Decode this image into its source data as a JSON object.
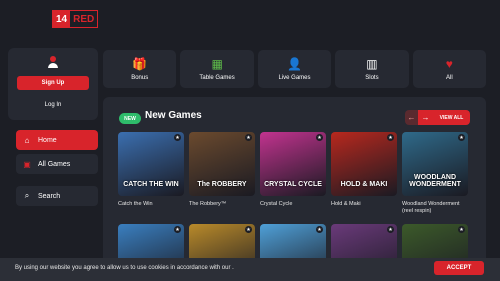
{
  "logo": {
    "number": "14",
    "brand": "RED"
  },
  "account": {
    "signup_label": "Sign Up",
    "login_label": "Log In"
  },
  "nav": [
    {
      "label": "Home",
      "icon": "home-icon",
      "active": true
    },
    {
      "label": "All Games",
      "icon": "cards-icon",
      "active": false
    },
    {
      "label": "Search",
      "icon": "search-icon",
      "active": false
    }
  ],
  "categories": [
    {
      "label": "Bonus",
      "icon": "gift-icon"
    },
    {
      "label": "Table Games",
      "icon": "roulette-icon"
    },
    {
      "label": "Live Games",
      "icon": "dealer-icon"
    },
    {
      "label": "Slots",
      "icon": "slot-machine-icon"
    },
    {
      "label": "All",
      "icon": "playing-cards-icon"
    }
  ],
  "section": {
    "badge": "NEW",
    "title": "New Games",
    "view_all": "VIEW ALL"
  },
  "games": [
    {
      "name": "Catch the Win",
      "art": "CATCH THE WIN",
      "color": "#3b6fb0"
    },
    {
      "name": "The Robbery™",
      "art": "The ROBBERY",
      "color": "#6b4a2e"
    },
    {
      "name": "Crystal Cycle",
      "art": "CRYSTAL CYCLE",
      "color": "#c2338f"
    },
    {
      "name": "Hold & Maki",
      "art": "HOLD & MAKI",
      "color": "#b8281e"
    },
    {
      "name": "Woodland Wonderment (reel respin)",
      "art": "WOODLAND WONDERMENT",
      "color": "#2f6a8a"
    }
  ],
  "games_row2_colors": [
    "#3a7fc0",
    "#b98a2a",
    "#4fa0d8",
    "#6a3a7a",
    "#3c5a2a"
  ],
  "cookie": {
    "text": "By using our website you agree to allow us to use cookies in accordance with our .",
    "accept_label": "ACCEPT"
  }
}
